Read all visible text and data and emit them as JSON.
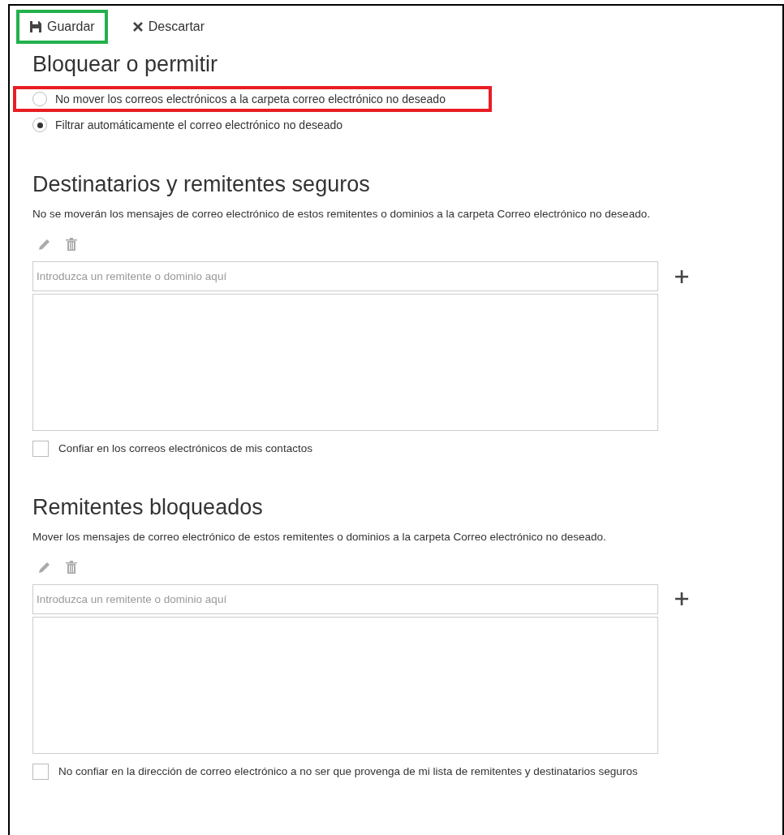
{
  "toolbar": [
    {
      "kind": "save",
      "label": "Guardar",
      "highlighted": true
    },
    {
      "kind": "discard",
      "label": "Descartar",
      "highlighted": false
    }
  ],
  "title": "Bloquear o permitir",
  "options": [
    {
      "label": "No mover los correos electrónicos a la carpeta correo electrónico no deseado",
      "selected": false,
      "highlighted": true
    },
    {
      "label": "Filtrar automáticamente el correo electrónico no deseado",
      "selected": true,
      "highlighted": false
    }
  ],
  "sections": [
    {
      "heading": "Destinatarios y remitentes seguros",
      "description": "No se moverán los mensajes de correo electrónico de estos remitentes o dominios a la carpeta Correo electrónico no deseado.",
      "input": {
        "placeholder": "Introduzca un remitente o dominio aquí"
      },
      "checkbox": {
        "label": "Confiar en los correos electrónicos de mis contactos",
        "checked": false
      }
    },
    {
      "heading": "Remitentes bloqueados",
      "description": "Mover los mensajes de correo electrónico de estos remitentes o dominios a la carpeta Correo electrónico no deseado.",
      "input": {
        "placeholder": "Introduzca un remitente o dominio aquí"
      },
      "checkbox": {
        "label": "No confiar en la dirección de correo electrónico a no ser que provenga de mi lista de remitentes y destinatarios seguros",
        "checked": false
      }
    }
  ]
}
